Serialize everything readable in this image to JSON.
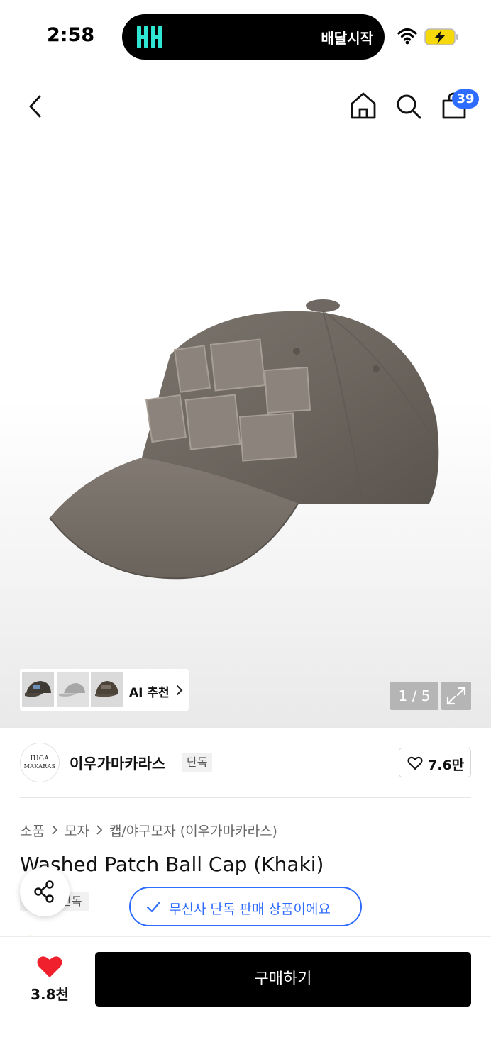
{
  "status_bar": {
    "time": "2:58",
    "island_text": "배달시작",
    "island_logo": "baemin-logo",
    "icons": [
      "wifi-icon",
      "battery-charging-icon"
    ]
  },
  "header": {
    "icons": [
      "back-icon",
      "home-icon",
      "search-icon",
      "cart-icon"
    ],
    "cart_count": "39",
    "accent_color": "#2e6bff"
  },
  "gallery": {
    "ai_label": "AI 추천",
    "page_indicator": "1 / 5",
    "image": "khaki-washed-patch-ball-cap"
  },
  "brand": {
    "logo_line1": "IUGA",
    "logo_line2": "MAKARAS",
    "name": "이우가마카라스",
    "exclusive_tag": "단독",
    "likes": "7.6만"
  },
  "breadcrumb": {
    "items": [
      "소품",
      "모자",
      "캡/야구모자 (이우가마카라스)"
    ]
  },
  "product": {
    "title": "Washed Patch Ball Cap (Khaki)",
    "exclusive_tag": "단독",
    "exclusive_notice": "무신사 단독 판매 상품이에요"
  },
  "bottom_bar": {
    "like_count": "3.8천",
    "buy_label": "구매하기",
    "heart_color": "#f0212c"
  }
}
